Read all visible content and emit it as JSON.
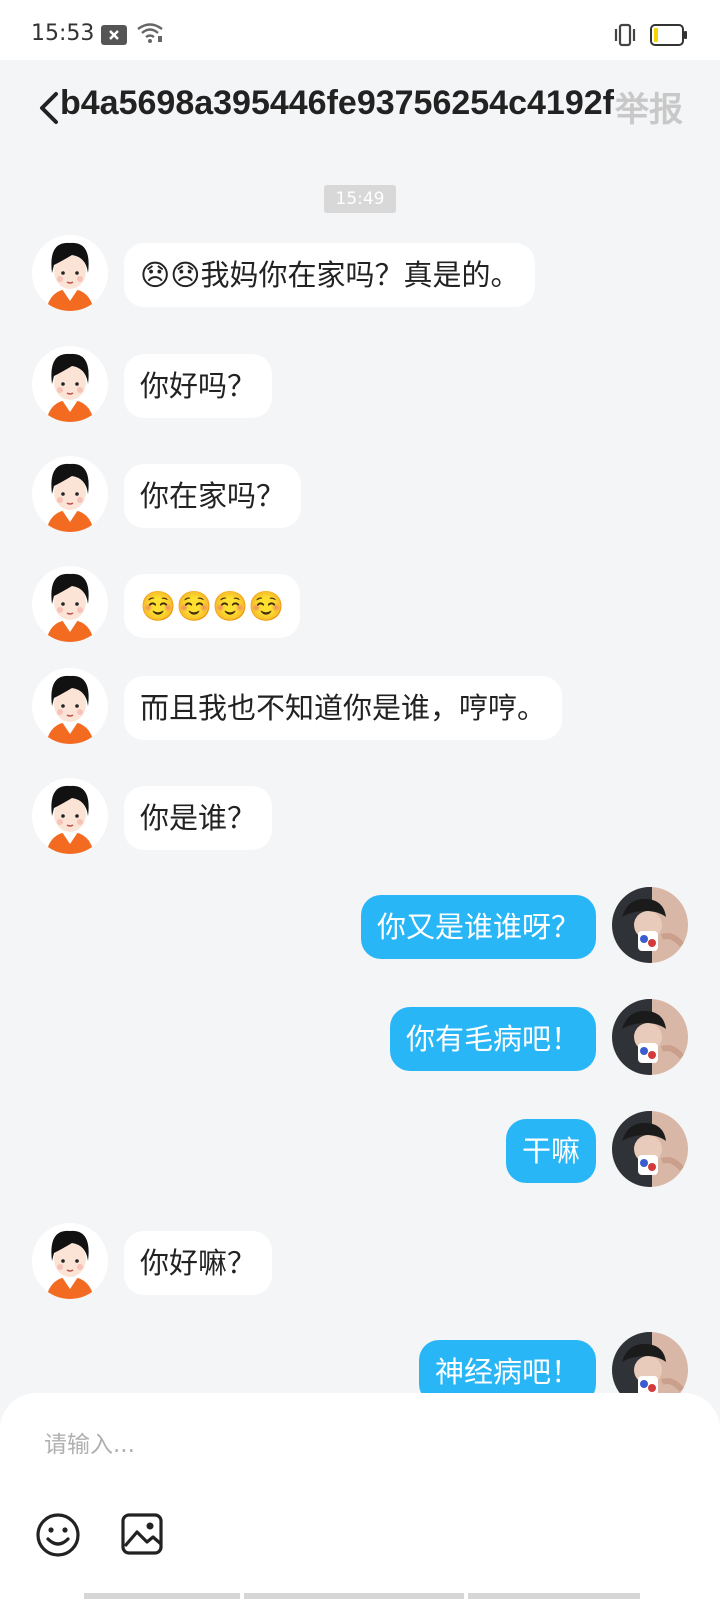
{
  "status_bar": {
    "time": "15:53"
  },
  "header": {
    "title": "b4a5698a395446fe93756254c4192f",
    "report_label": "举报"
  },
  "chat": {
    "timestamp": "15:49",
    "messages": [
      {
        "side": "in",
        "text": "😞😞我妈你在家吗？真是的。"
      },
      {
        "side": "in",
        "text": "你好吗？"
      },
      {
        "side": "in",
        "text": "你在家吗？"
      },
      {
        "side": "in",
        "text": "☺️☺️☺️☺️"
      },
      {
        "side": "in",
        "text": "而且我也不知道你是谁，哼哼。"
      },
      {
        "side": "in",
        "text": "你是谁？"
      },
      {
        "side": "out",
        "text": "你又是谁谁呀？"
      },
      {
        "side": "out",
        "text": "你有毛病吧！"
      },
      {
        "side": "out",
        "text": "干嘛"
      },
      {
        "side": "in",
        "text": "你好嘛？"
      },
      {
        "side": "out",
        "text": "神经病吧！"
      }
    ]
  },
  "composer": {
    "placeholder": "请输入..."
  },
  "colors": {
    "outgoing_bubble": "#29b6f6",
    "incoming_bubble": "#ffffff",
    "background": "#f4f5f7"
  }
}
